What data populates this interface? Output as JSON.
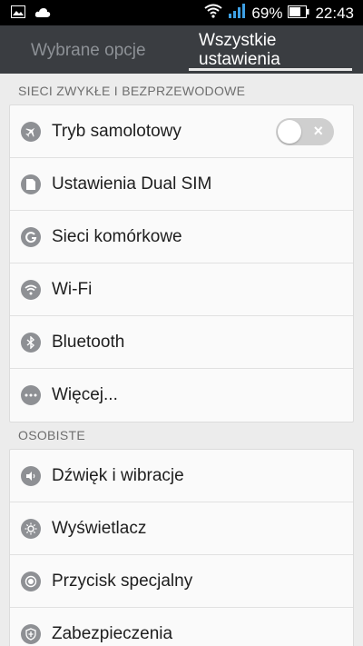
{
  "status_bar": {
    "battery": "69%",
    "time": "22:43"
  },
  "tabs": [
    {
      "label": "Wybrane opcje"
    },
    {
      "label_line1": "Wszystkie",
      "label_line2": "ustawienia"
    }
  ],
  "sections": [
    {
      "title": "SIECI ZWYKŁE I BEZPRZEWODOWE",
      "items": [
        {
          "label": "Tryb samolotowy",
          "icon": "airplane-icon"
        },
        {
          "label": "Ustawienia Dual SIM",
          "icon": "sim-icon"
        },
        {
          "label": "Sieci komórkowe",
          "icon": "cellular-icon"
        },
        {
          "label": "Wi-Fi",
          "icon": "wifi-icon"
        },
        {
          "label": "Bluetooth",
          "icon": "bluetooth-icon"
        },
        {
          "label": "Więcej...",
          "icon": "more-icon"
        }
      ]
    },
    {
      "title": "OSOBISTE",
      "items": [
        {
          "label": "Dźwięk i wibracje",
          "icon": "sound-icon"
        },
        {
          "label": "Wyświetlacz",
          "icon": "brightness-icon"
        },
        {
          "label": "Przycisk specjalny",
          "icon": "special-button-icon"
        },
        {
          "label": "Zabezpieczenia",
          "icon": "shield-icon"
        }
      ]
    }
  ],
  "toggle_close_glyph": "×"
}
